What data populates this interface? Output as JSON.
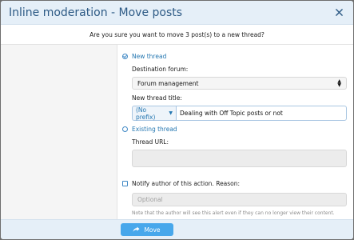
{
  "dialog": {
    "title": "Inline moderation - Move posts",
    "close_icon": "close-icon",
    "question": "Are you sure you want to move 3 post(s) to a new thread?"
  },
  "new_thread": {
    "label": "New thread",
    "checked": true,
    "destination_label": "Destination forum:",
    "destination_value": "Forum management",
    "title_label": "New thread title:",
    "prefix_value": "(No prefix)",
    "title_value": "Dealing with Off Topic posts or not"
  },
  "existing_thread": {
    "label": "Existing thread",
    "checked": false,
    "url_label": "Thread URL:",
    "url_value": ""
  },
  "notify": {
    "label": "Notify author of this action. Reason:",
    "checked": false,
    "reason_placeholder": "Optional",
    "note": "Note that the author will see this alert even if they can no longer view their content."
  },
  "footer": {
    "move_label": "Move",
    "move_icon": "share-arrow-icon"
  },
  "colors": {
    "header_bg": "#e5eff8",
    "title_text": "#2d5a85",
    "accent": "#2577b1",
    "button_bg": "#47a7eb"
  }
}
